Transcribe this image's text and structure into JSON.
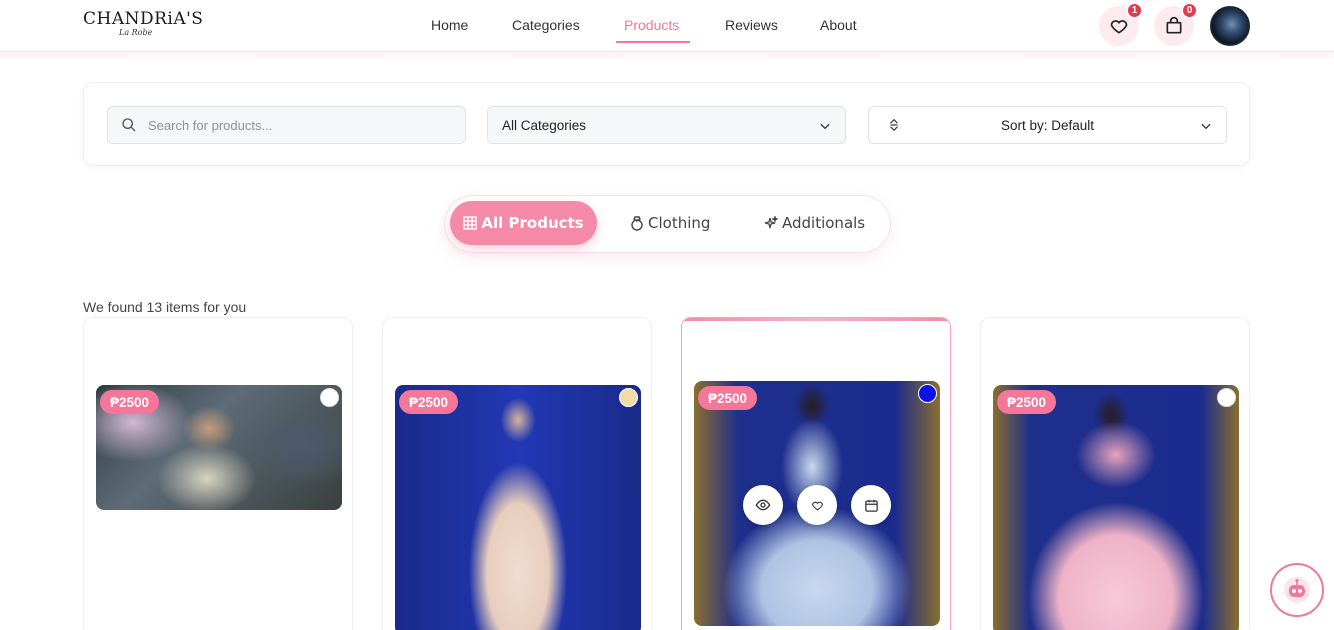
{
  "brand": {
    "name": "CHANDRiA'S",
    "tagline": "La Robe"
  },
  "nav": {
    "home": "Home",
    "categories": "Categories",
    "products": "Products",
    "reviews": "Reviews",
    "about": "About"
  },
  "header": {
    "wishlist_count": "1",
    "cart_count": "0"
  },
  "filters": {
    "search_placeholder": "Search for products...",
    "category_selected": "All Categories",
    "sort_selected": "Sort by: Default"
  },
  "tabs": {
    "all": "All Products",
    "clothing": "Clothing",
    "additionals": "Additionals"
  },
  "results": {
    "found_text": "We found 13 items for you"
  },
  "products": [
    {
      "price": "₱2500",
      "color": "#ffffff"
    },
    {
      "price": "₱2500",
      "color": "#f3dba6"
    },
    {
      "price": "₱2500",
      "color": "#0a12e6"
    },
    {
      "price": "₱2500",
      "color": "#ffffff"
    }
  ],
  "icons": [
    "heart-icon",
    "shopping-bag-icon",
    "search-icon",
    "chevron-down-icon",
    "sort-icon",
    "grid-icon",
    "ring-icon",
    "sparkle-icon",
    "eye-icon",
    "calendar-icon",
    "robot-icon"
  ],
  "colors": {
    "accent": "#f2779a",
    "badge": "#e8384f"
  }
}
